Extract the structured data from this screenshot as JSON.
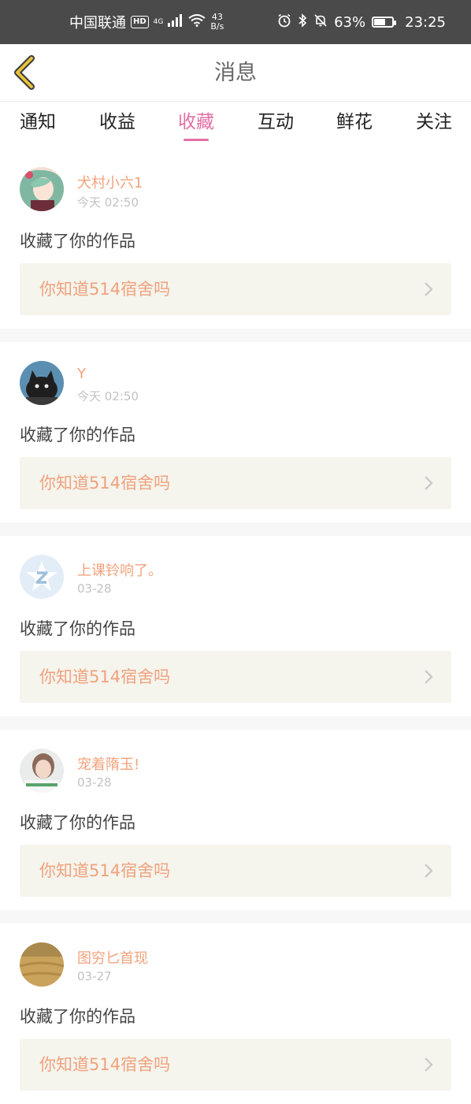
{
  "status_bar": {
    "carrier": "中国联通",
    "hd": "HD",
    "signal_label": "4G",
    "net_speed_value": "43",
    "net_speed_unit": "B/s",
    "battery_percent": "63%",
    "battery_level": 0.63,
    "time": "23:25"
  },
  "header": {
    "title": "消息"
  },
  "tabs": [
    {
      "label": "通知",
      "active": false
    },
    {
      "label": "收益",
      "active": false
    },
    {
      "label": "收藏",
      "active": true
    },
    {
      "label": "互动",
      "active": false
    },
    {
      "label": "鲜花",
      "active": false
    },
    {
      "label": "关注",
      "active": false
    }
  ],
  "messages": [
    {
      "user": "犬村小六1",
      "time": "今天 02:50",
      "action": "收藏了你的作品",
      "work": "你知道514宿舍吗",
      "avatar": "anime-girl-avatar"
    },
    {
      "user": "Y",
      "time": "今天 02:50",
      "action": "收藏了你的作品",
      "work": "你知道514宿舍吗",
      "avatar": "cat-avatar"
    },
    {
      "user": "上课铃响了。",
      "time": "03-28",
      "action": "收藏了你的作品",
      "work": "你知道514宿舍吗",
      "avatar": "default-z-avatar"
    },
    {
      "user": "宠着隋玉!",
      "time": "03-28",
      "action": "收藏了你的作品",
      "work": "你知道514宿舍吗",
      "avatar": "girl-photo-avatar"
    },
    {
      "user": "图穷匕首现",
      "time": "03-27",
      "action": "收藏了你的作品",
      "work": "你知道514宿舍吗",
      "avatar": "field-avatar"
    }
  ],
  "colors": {
    "accent": "#e46fa4",
    "username": "#f2a27c",
    "work_title": "#f0a27d",
    "back_arrow": "#e8c23a"
  }
}
